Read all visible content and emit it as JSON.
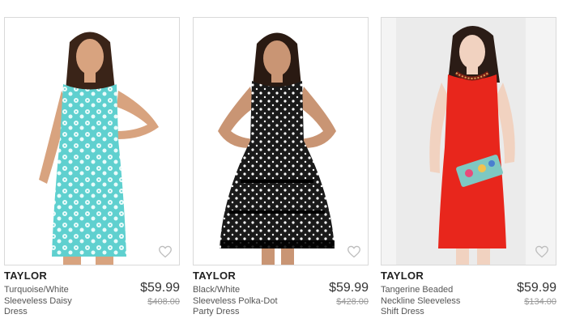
{
  "products": [
    {
      "brand": "TAYLOR",
      "title": "Turquoise/White Sleeveless Daisy Dress",
      "price": "$59.99",
      "original_price": "$408.00",
      "wishlist_icon": "heart-outline-icon",
      "dress_color": "#5fd0cf"
    },
    {
      "brand": "TAYLOR",
      "title": "Black/White Sleeveless Polka-Dot Party Dress",
      "price": "$59.99",
      "original_price": "$428.00",
      "wishlist_icon": "heart-outline-icon",
      "dress_color": "#1a1a1a"
    },
    {
      "brand": "TAYLOR",
      "title": "Tangerine Beaded Neckline Sleeveless Shift Dress",
      "price": "$59.99",
      "original_price": "$134.00",
      "wishlist_icon": "heart-outline-icon",
      "dress_color": "#e8261c"
    }
  ]
}
